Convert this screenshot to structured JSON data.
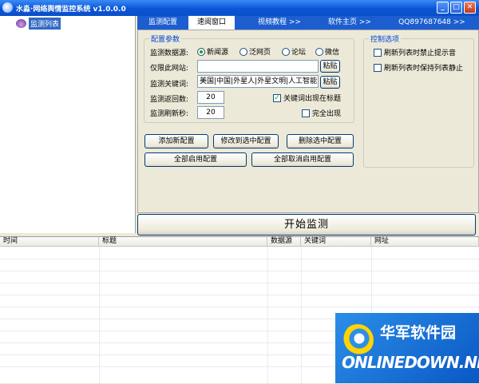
{
  "window": {
    "title": "水淼·网络舆情监控系统 v1.0.0.0",
    "minimize_icon": "minimize-icon",
    "maximize_icon": "maximize-icon",
    "close_icon": "close-icon"
  },
  "tree": {
    "root_label": "监测列表"
  },
  "tabs": [
    {
      "label": "监测配置"
    },
    {
      "label": "速阅窗口"
    },
    {
      "label": "视频教程 >>"
    },
    {
      "label": "软件主页 >>"
    },
    {
      "label": "QQ897687648 >>"
    }
  ],
  "config": {
    "group_title": "配置参数",
    "source_label": "监测数据源:",
    "sources": [
      {
        "label": "新闻源",
        "selected": true
      },
      {
        "label": "泛网页",
        "selected": false
      },
      {
        "label": "论坛",
        "selected": false
      },
      {
        "label": "微信",
        "selected": false
      }
    ],
    "site_label": "仅限此网站:",
    "site_value": "",
    "paste1": "粘贴",
    "keyword_label": "监测关键词:",
    "keyword_value": "美国|中国|外星人|外星文明|人工智能",
    "paste2": "粘贴",
    "pages_label": "监测返回数:",
    "pages_value": "20",
    "refresh_label": "监测刷新秒:",
    "refresh_value": "20",
    "keyword_in_title": {
      "label": "关键词出现在标题",
      "checked": true
    },
    "full_match": {
      "label": "完全出现",
      "checked": false
    }
  },
  "control": {
    "group_title": "控制选项",
    "no_sound": {
      "label": "刷新列表时禁止提示音",
      "checked": false
    },
    "keep_list": {
      "label": "刷新列表时保持列表静止",
      "checked": false
    }
  },
  "buttons": {
    "add": "添加新配置",
    "modify": "修改到选中配置",
    "delete": "删除选中配置",
    "enable_all": "全部启用配置",
    "disable_all": "全部取消启用配置",
    "start": "开始监测"
  },
  "table": {
    "columns": [
      "时间",
      "标题",
      "数据源",
      "关键词",
      "网址"
    ]
  },
  "watermark": {
    "cn": "华军软件园",
    "en": "ONLINEDOWN.NET"
  }
}
